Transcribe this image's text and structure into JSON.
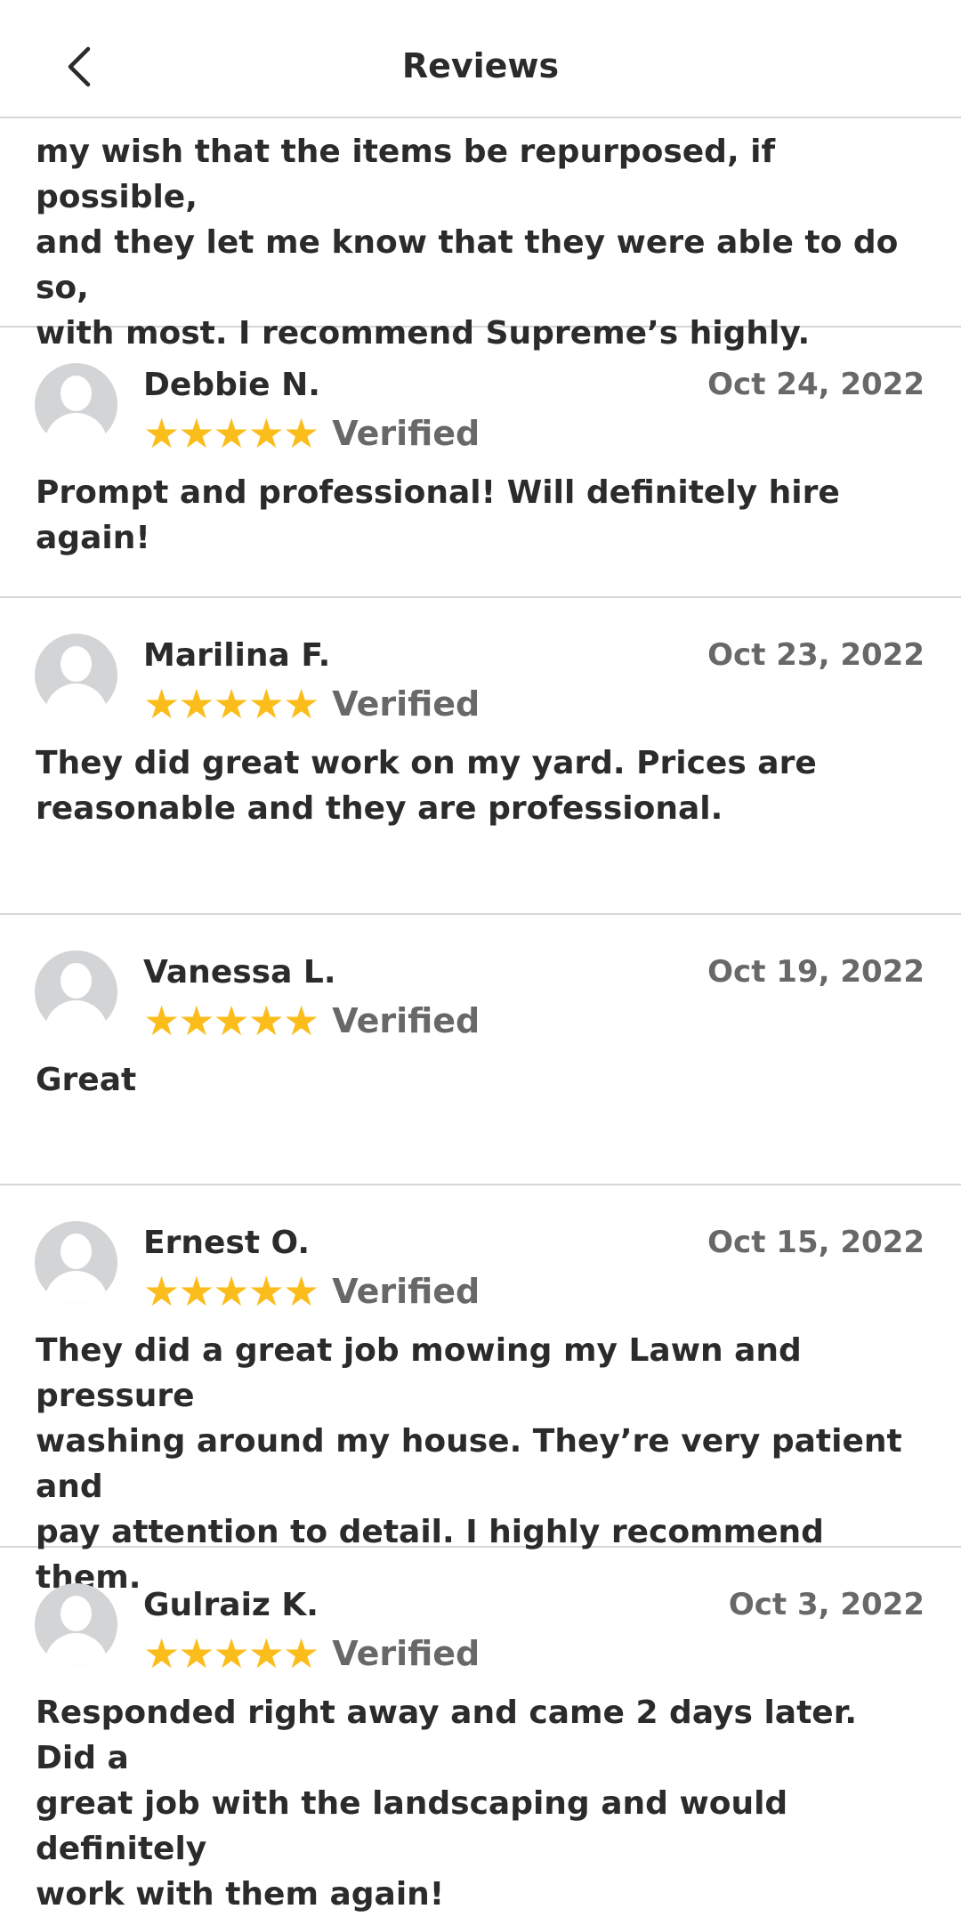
{
  "header": {
    "title": "Reviews"
  },
  "partial_review": {
    "text_lines": [
      "my wish that the items be repurposed, if possible,",
      "and they let me know that they were able to do so,",
      "with most. I recommend Supreme’s highly."
    ]
  },
  "verified_label": "Verified",
  "colors": {
    "star": "#fbbd1c",
    "muted_text": "#686868",
    "avatar": "#d3d4d6"
  },
  "reviews": [
    {
      "name": "Debbie N.",
      "date": "Oct 24, 2022",
      "stars": 5,
      "text_lines": [
        "Prompt and professional! Will definitely hire again!"
      ]
    },
    {
      "name": "Marilina F.",
      "date": "Oct 23, 2022",
      "stars": 5,
      "text_lines": [
        "They did great work on my yard. Prices are",
        "reasonable and they are professional."
      ]
    },
    {
      "name": "Vanessa L.",
      "date": "Oct 19, 2022",
      "stars": 5,
      "text_lines": [
        "Great"
      ]
    },
    {
      "name": "Ernest O.",
      "date": "Oct 15, 2022",
      "stars": 5,
      "text_lines": [
        "They did a great job mowing my Lawn and pressure",
        "washing around my house. They’re very patient and",
        "pay attention to detail. I highly recommend them."
      ]
    },
    {
      "name": "Gulraiz K.",
      "date": "Oct 3, 2022",
      "stars": 5,
      "text_lines": [
        "Responded right away and came 2 days later. Did a",
        "great job with the landscaping and would definitely",
        "work with them again!"
      ]
    }
  ]
}
